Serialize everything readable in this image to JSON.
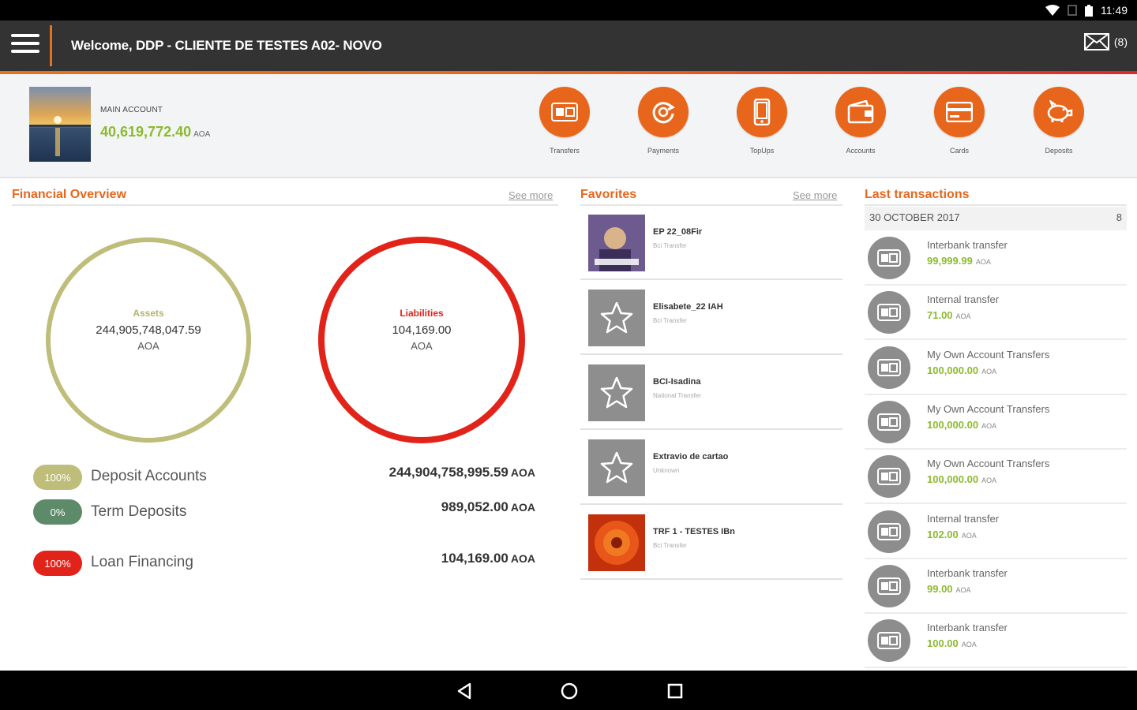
{
  "status_bar": {
    "time": "11:49"
  },
  "header": {
    "welcome": "Welcome, DDP - CLIENTE DE TESTES A02- NOVO",
    "messages_count": "(8)"
  },
  "account": {
    "label": "MAIN ACCOUNT",
    "balance": "40,619,772.40",
    "currency": "AOA"
  },
  "quick_actions": [
    {
      "label": "Transfers",
      "icon": "transfer-icon"
    },
    {
      "label": "Payments",
      "icon": "payment-icon"
    },
    {
      "label": "TopUps",
      "icon": "phone-icon"
    },
    {
      "label": "Accounts",
      "icon": "wallet-icon"
    },
    {
      "label": "Cards",
      "icon": "card-icon"
    },
    {
      "label": "Deposits",
      "icon": "piggy-bank-icon"
    }
  ],
  "financial_overview": {
    "title": "Financial Overview",
    "see_more": "See more",
    "assets": {
      "label": "Assets",
      "value": "244,905,748,047.59",
      "currency": "AOA",
      "color": "#bfbd7a"
    },
    "liabilities": {
      "label": "Liabilities",
      "value": "104,169.00",
      "currency": "AOA",
      "color": "#e2231a"
    },
    "rows": [
      {
        "pct": "100%",
        "name": "Deposit Accounts",
        "amount": "244,904,758,995.59",
        "currency": "AOA",
        "color": "#bfbd7a"
      },
      {
        "pct": "0%",
        "name": "Term Deposits",
        "amount": "989,052.00",
        "currency": "AOA",
        "color": "#5d8a68"
      },
      {
        "pct": "100%",
        "name": "Loan Financing",
        "amount": "104,169.00",
        "currency": "AOA",
        "color": "#e2231a"
      }
    ]
  },
  "favorites": {
    "title": "Favorites",
    "see_more": "See more",
    "items": [
      {
        "name": "EP 22_08Fir",
        "type": "Bci Transfer"
      },
      {
        "name": "Elisabete_22 IAH",
        "type": "Bci Transfer"
      },
      {
        "name": "BCI-Isadina",
        "type": "National Transfer"
      },
      {
        "name": "Extravio de cartao",
        "type": "Unknown"
      },
      {
        "name": "TRF 1 - TESTES IBn",
        "type": "Bci Transfer"
      }
    ]
  },
  "transactions": {
    "title": "Last transactions",
    "date": "30 OCTOBER 2017",
    "count": "8",
    "items": [
      {
        "name": "Interbank transfer",
        "amount": "99,999.99",
        "currency": "AOA"
      },
      {
        "name": "Internal transfer",
        "amount": "71.00",
        "currency": "AOA"
      },
      {
        "name": "My Own Account Transfers",
        "amount": "100,000.00",
        "currency": "AOA"
      },
      {
        "name": "My Own Account Transfers",
        "amount": "100,000.00",
        "currency": "AOA"
      },
      {
        "name": "My Own Account Transfers",
        "amount": "100,000.00",
        "currency": "AOA"
      },
      {
        "name": "Internal transfer",
        "amount": "102.00",
        "currency": "AOA"
      },
      {
        "name": "Interbank transfer",
        "amount": "99.00",
        "currency": "AOA"
      },
      {
        "name": "Interbank transfer",
        "amount": "100.00",
        "currency": "AOA"
      }
    ]
  },
  "colors": {
    "brand_orange": "#e8661c",
    "positive_green": "#8cba2f",
    "header_dark": "#333333"
  }
}
